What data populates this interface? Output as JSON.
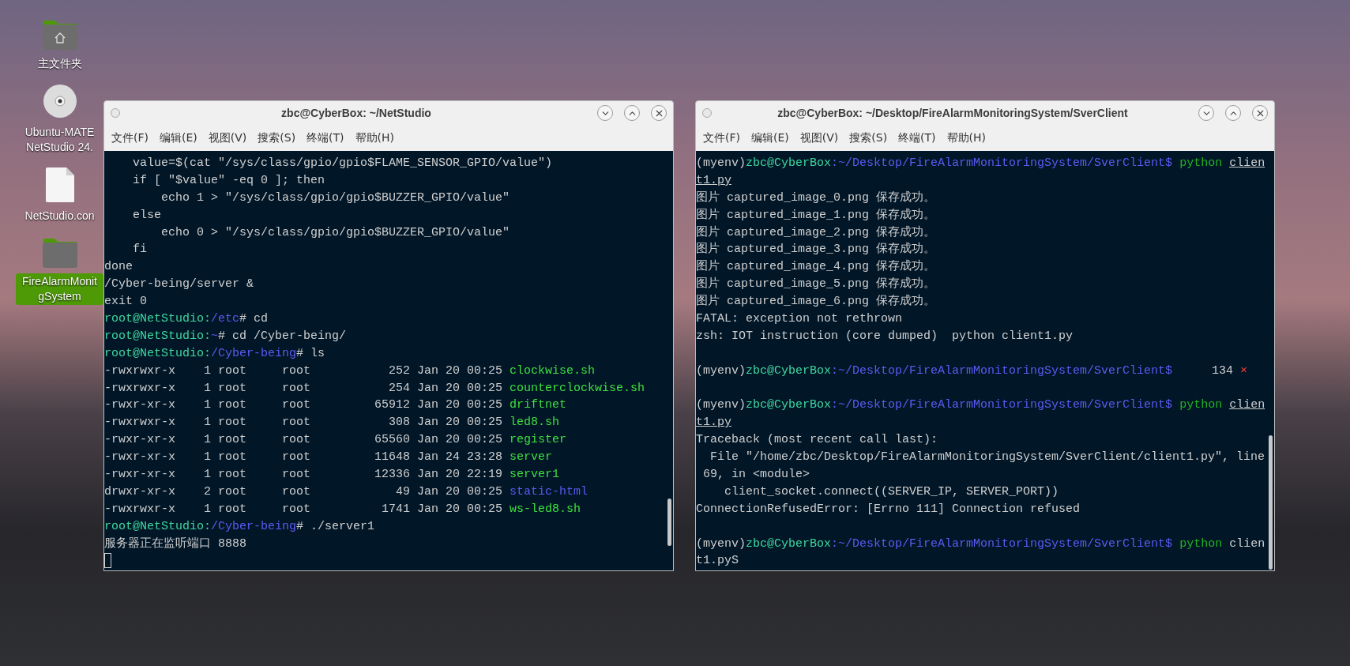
{
  "desktop_icons": [
    {
      "kind": "home_folder",
      "label": [
        "主文件夹"
      ],
      "selected": false
    },
    {
      "kind": "disc",
      "label": [
        "Ubuntu-MATE",
        "NetStudio 24."
      ],
      "selected": false
    },
    {
      "kind": "file",
      "label": [
        "NetStudio.con"
      ],
      "selected": false
    },
    {
      "kind": "folder",
      "label": [
        "FireAlarmMonit",
        "gSystem"
      ],
      "selected": true
    }
  ],
  "windows": [
    {
      "title": "zbc@CyberBox: ~/NetStudio",
      "menu": [
        "文件(F)",
        "编辑(E)",
        "视图(V)",
        "搜索(S)",
        "终端(T)",
        "帮助(H)"
      ],
      "lines": [
        [
          {
            "kind": "plain",
            "text": "    value=$(cat \"/sys/class/gpio/gpio$FLAME_SENSOR_GPIO/value\")"
          }
        ],
        [
          {
            "kind": "plain",
            "text": "    if [ \"$value\" -eq 0 ]; then"
          }
        ],
        [
          {
            "kind": "plain",
            "text": "        echo 1 > \"/sys/class/gpio/gpio$BUZZER_GPIO/value\""
          }
        ],
        [
          {
            "kind": "plain",
            "text": "    else"
          }
        ],
        [
          {
            "kind": "plain",
            "text": "        echo 0 > \"/sys/class/gpio/gpio$BUZZER_GPIO/value\""
          }
        ],
        [
          {
            "kind": "plain",
            "text": "    fi"
          }
        ],
        [
          {
            "kind": "plain",
            "text": "done"
          }
        ],
        [
          {
            "kind": "plain",
            "text": "/Cyber-being/server &"
          }
        ],
        [
          {
            "kind": "plain",
            "text": "exit 0"
          }
        ],
        [
          {
            "kind": "user",
            "text": "root@NetStudio:"
          },
          {
            "kind": "path",
            "text": "/etc"
          },
          {
            "kind": "plain",
            "text": "# cd"
          }
        ],
        [
          {
            "kind": "user",
            "text": "root@NetStudio:"
          },
          {
            "kind": "path",
            "text": "~"
          },
          {
            "kind": "plain",
            "text": "# cd /Cyber-being/"
          }
        ],
        [
          {
            "kind": "user",
            "text": "root@NetStudio:"
          },
          {
            "kind": "path",
            "text": "/Cyber-being"
          },
          {
            "kind": "plain",
            "text": "# ls"
          }
        ],
        [
          {
            "kind": "plain",
            "text": "-rwxrwxr-x    1 root     root           252 Jan 20 00:25 "
          },
          {
            "kind": "exec",
            "text": "clockwise.sh"
          }
        ],
        [
          {
            "kind": "plain",
            "text": "-rwxrwxr-x    1 root     root           254 Jan 20 00:25 "
          },
          {
            "kind": "exec",
            "text": "counterclockwise.sh"
          }
        ],
        [
          {
            "kind": "plain",
            "text": "-rwxr-xr-x    1 root     root         65912 Jan 20 00:25 "
          },
          {
            "kind": "exec",
            "text": "driftnet"
          }
        ],
        [
          {
            "kind": "plain",
            "text": "-rwxrwxr-x    1 root     root           308 Jan 20 00:25 "
          },
          {
            "kind": "exec",
            "text": "led8.sh"
          }
        ],
        [
          {
            "kind": "plain",
            "text": "-rwxr-xr-x    1 root     root         65560 Jan 20 00:25 "
          },
          {
            "kind": "exec",
            "text": "register"
          }
        ],
        [
          {
            "kind": "plain",
            "text": "-rwxr-xr-x    1 root     root         11648 Jan 24 23:28 "
          },
          {
            "kind": "exec",
            "text": "server"
          }
        ],
        [
          {
            "kind": "plain",
            "text": "-rwxr-xr-x    1 root     root         12336 Jan 20 22:19 "
          },
          {
            "kind": "exec",
            "text": "server1"
          }
        ],
        [
          {
            "kind": "plain",
            "text": "drwxr-xr-x    2 root     root            49 Jan 20 00:25 "
          },
          {
            "kind": "dir",
            "text": "static-html"
          }
        ],
        [
          {
            "kind": "plain",
            "text": "-rwxrwxr-x    1 root     root          1741 Jan 20 00:25 "
          },
          {
            "kind": "exec",
            "text": "ws-led8.sh"
          }
        ],
        [
          {
            "kind": "user",
            "text": "root@NetStudio:"
          },
          {
            "kind": "path",
            "text": "/Cyber-being"
          },
          {
            "kind": "plain",
            "text": "# ./server1"
          }
        ],
        [
          {
            "kind": "plain",
            "text": "服务器正在监听端口 8888"
          }
        ]
      ]
    },
    {
      "title": "zbc@CyberBox: ~/Desktop/FireAlarmMonitoringSystem/SverClient",
      "menu": [
        "文件(F)",
        "编辑(E)",
        "视图(V)",
        "搜索(S)",
        "终端(T)",
        "帮助(H)"
      ],
      "lines": [
        [
          {
            "kind": "plain",
            "text": "(myenv)"
          },
          {
            "kind": "user",
            "text": "zbc@CyberBox"
          },
          {
            "kind": "path",
            "text": ":~/Desktop/FireAlarmMonitoringSystem/SverClient$"
          },
          {
            "kind": "cmd",
            "text": " python "
          },
          {
            "kind": "file_link",
            "text": "clien"
          }
        ],
        [
          {
            "kind": "file_link",
            "text": "t1.py"
          }
        ],
        [
          {
            "kind": "plain",
            "text": "图片 captured_image_0.png 保存成功。"
          }
        ],
        [
          {
            "kind": "plain",
            "text": "图片 captured_image_1.png 保存成功。"
          }
        ],
        [
          {
            "kind": "plain",
            "text": "图片 captured_image_2.png 保存成功。"
          }
        ],
        [
          {
            "kind": "plain",
            "text": "图片 captured_image_3.png 保存成功。"
          }
        ],
        [
          {
            "kind": "plain",
            "text": "图片 captured_image_4.png 保存成功。"
          }
        ],
        [
          {
            "kind": "plain",
            "text": "图片 captured_image_5.png 保存成功。"
          }
        ],
        [
          {
            "kind": "plain",
            "text": "图片 captured_image_6.png 保存成功。"
          }
        ],
        [
          {
            "kind": "plain",
            "text": "FATAL: exception not rethrown"
          }
        ],
        [
          {
            "kind": "plain",
            "text": "zsh: IOT instruction (core dumped)  python client1.py"
          }
        ],
        [
          {
            "kind": "blank"
          }
        ],
        [
          {
            "kind": "plain",
            "text": "(myenv)"
          },
          {
            "kind": "user",
            "text": "zbc@CyberBox"
          },
          {
            "kind": "path",
            "text": ":~/Desktop/FireAlarmMonitoringSystem/SverClient$"
          },
          {
            "kind": "status",
            "text": "134"
          },
          {
            "kind": "error_mark",
            "text": "×"
          }
        ],
        [
          {
            "kind": "blank"
          }
        ],
        [
          {
            "kind": "plain",
            "text": "(myenv)"
          },
          {
            "kind": "user",
            "text": "zbc@CyberBox"
          },
          {
            "kind": "path",
            "text": ":~/Desktop/FireAlarmMonitoringSystem/SverClient$"
          },
          {
            "kind": "cmd",
            "text": " python "
          },
          {
            "kind": "file_link",
            "text": "clien"
          }
        ],
        [
          {
            "kind": "file_link",
            "text": "t1.py"
          }
        ],
        [
          {
            "kind": "plain",
            "text": "Traceback (most recent call last):"
          }
        ],
        [
          {
            "kind": "plain",
            "text": "  File \"/home/zbc/Desktop/FireAlarmMonitoringSystem/SverClient/client1.py\", line"
          }
        ],
        [
          {
            "kind": "plain",
            "text": " 69, in <module>"
          }
        ],
        [
          {
            "kind": "plain",
            "text": "    client_socket.connect((SERVER_IP, SERVER_PORT))"
          }
        ],
        [
          {
            "kind": "plain",
            "text": "ConnectionRefusedError: [Errno 111] Connection refused"
          }
        ],
        [
          {
            "kind": "blank"
          }
        ],
        [
          {
            "kind": "plain",
            "text": "(myenv)"
          },
          {
            "kind": "user",
            "text": "zbc@CyberBox"
          },
          {
            "kind": "path",
            "text": ":~/Desktop/FireAlarmMonitoringSystem/SverClient$"
          },
          {
            "kind": "cmd",
            "text": " python"
          },
          {
            "kind": "plain",
            "text": " clien"
          }
        ],
        [
          {
            "kind": "plain",
            "text": "t1.pyS"
          }
        ]
      ]
    }
  ]
}
